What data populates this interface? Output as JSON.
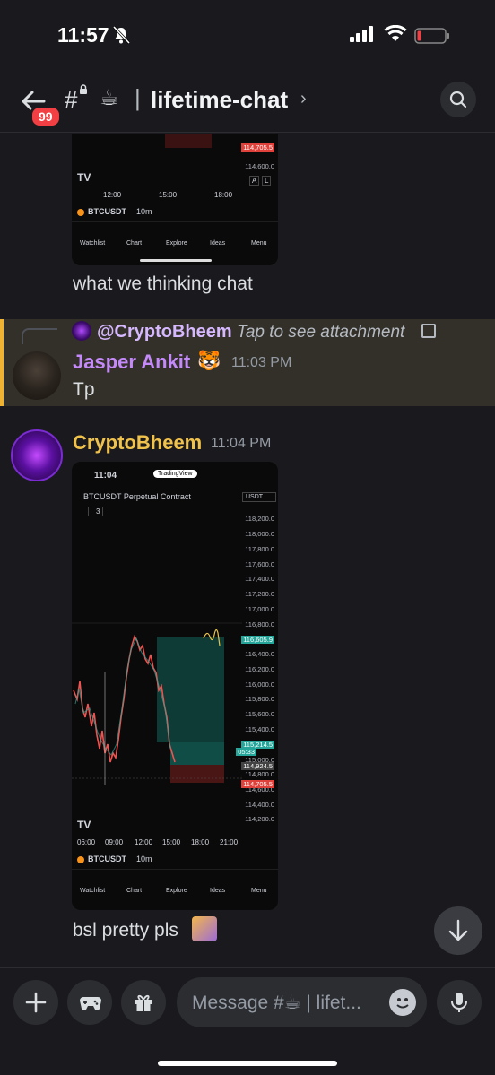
{
  "status": {
    "time": "11:57"
  },
  "header": {
    "unread_badge": "99",
    "channel_prefix": "#",
    "channel_emoji": "☕",
    "separator": "|",
    "channel_name": "lifetime-chat",
    "chevron": "›"
  },
  "messages": [
    {
      "type": "continuation",
      "attachment": {
        "price_label": "114,705.5",
        "axis": [
          "114,600.0"
        ],
        "scale_buttons": [
          "A",
          "L"
        ],
        "time_axis": [
          "12:00",
          "15:00",
          "18:00"
        ],
        "symbol": "BTCUSDT",
        "interval": "10m",
        "nav": [
          "Watchlist",
          "Chart",
          "Explore",
          "Ideas",
          "Menu"
        ]
      },
      "text": "what we thinking chat"
    },
    {
      "type": "reply",
      "reply_to": {
        "name": "@CryptoBheem",
        "preview": "Tap to see attachment"
      },
      "author": "Jasper Ankit",
      "author_emoji": "🐯",
      "time": "11:03 PM",
      "text": "Tp"
    },
    {
      "type": "message",
      "author": "CryptoBheem",
      "time": "11:04 PM",
      "attachment": {
        "phone_time": "11:04",
        "app_badge": "TradingView",
        "title": "BTCUSDT Perpetual Contract",
        "currency": "USDT",
        "count": "3",
        "axis": [
          "118,200.0",
          "118,000.0",
          "117,800.0",
          "117,600.0",
          "117,400.0",
          "117,200.0",
          "117,000.0",
          "116,800.0",
          "116,400.0",
          "116,200.0",
          "116,000.0",
          "115,800.0",
          "115,600.0",
          "115,400.0",
          "115,000.0",
          "114,800.0",
          "114,600.0",
          "114,400.0",
          "114,200.0"
        ],
        "price_labels": {
          "target": "116,605.9",
          "current": "115,214.5",
          "countdown": "05:33",
          "entry": "114,924.5",
          "stop": "114,705.5"
        },
        "time_axis": [
          "06:00",
          "09:00",
          "12:00",
          "15:00",
          "18:00",
          "21:00"
        ],
        "symbol": "BTCUSDT",
        "interval": "10m",
        "nav": [
          "Watchlist",
          "Chart",
          "Explore",
          "Ideas",
          "Menu"
        ]
      },
      "text": "bsl pretty pls"
    }
  ],
  "composer": {
    "placeholder": "Message #☕ | lifet..."
  },
  "colors": {
    "background": "#1a1a1e",
    "reply_highlight": "#33302a",
    "jasper_name": "#c58af9",
    "bheem_name": "#f0c24b",
    "badge": "#f23f43"
  }
}
